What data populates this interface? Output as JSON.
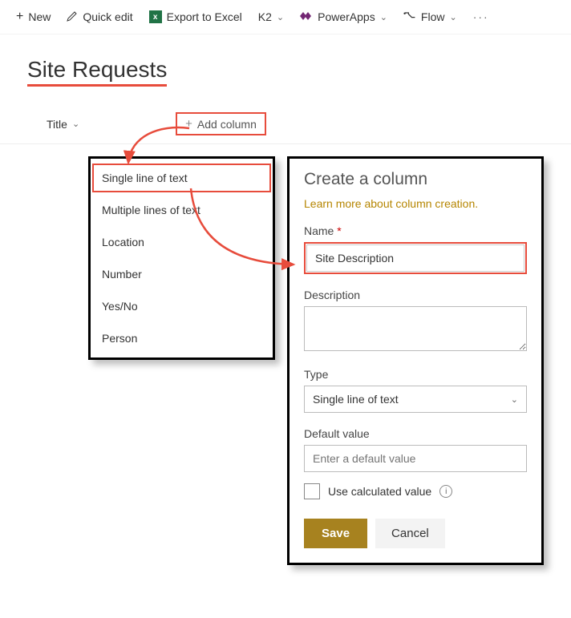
{
  "toolbar": {
    "new": "New",
    "quick_edit": "Quick edit",
    "export_excel": "Export to Excel",
    "k2": "K2",
    "powerapps": "PowerApps",
    "flow": "Flow"
  },
  "page": {
    "title": "Site Requests"
  },
  "list_header": {
    "title_col": "Title",
    "add_column": "Add column"
  },
  "type_menu": {
    "items": [
      "Single line of text",
      "Multiple lines of text",
      "Location",
      "Number",
      "Yes/No",
      "Person"
    ]
  },
  "panel": {
    "title": "Create a column",
    "link": "Learn more about column creation.",
    "name_label": "Name",
    "name_value": "Site Description",
    "description_label": "Description",
    "type_label": "Type",
    "type_value": "Single line of text",
    "default_label": "Default value",
    "default_placeholder": "Enter a default value",
    "calc_label": "Use calculated value",
    "save": "Save",
    "cancel": "Cancel"
  }
}
